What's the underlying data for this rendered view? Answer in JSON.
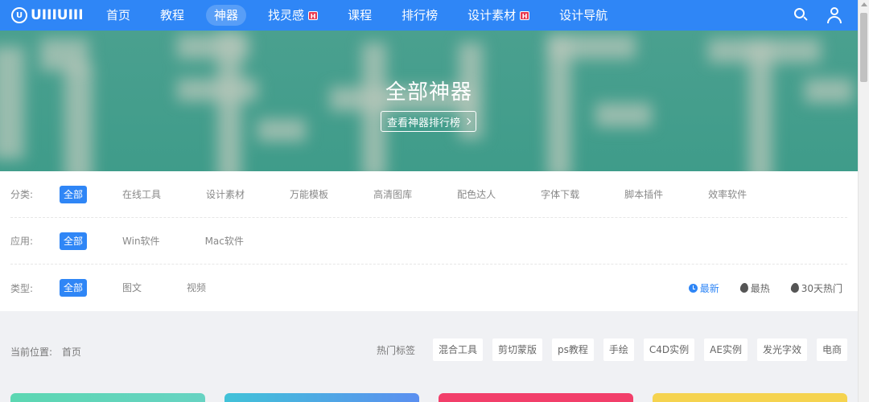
{
  "header": {
    "logo_text": "UIIIUIII",
    "logo_sub": "",
    "nav": [
      {
        "label": "首页",
        "hot": false
      },
      {
        "label": "教程",
        "hot": false
      },
      {
        "label": "神器",
        "hot": false,
        "active": true
      },
      {
        "label": "找灵感",
        "hot": true
      },
      {
        "label": "课程",
        "hot": false
      },
      {
        "label": "排行榜",
        "hot": false
      },
      {
        "label": "设计素材",
        "hot": true
      },
      {
        "label": "设计导航",
        "hot": false
      }
    ],
    "hot_badge": "H",
    "icons": [
      "search-icon",
      "user-icon"
    ],
    "bg_color": "#2f86f6"
  },
  "banner": {
    "title": "全部神器",
    "button_label": "查看神器排行榜"
  },
  "filters": {
    "rows": [
      {
        "label": "分类:",
        "options": [
          "全部",
          "在线工具",
          "设计素材",
          "万能模板",
          "高清图库",
          "配色达人",
          "字体下载",
          "脚本插件",
          "效率软件"
        ],
        "active": 0
      },
      {
        "label": "应用:",
        "options": [
          "全部",
          "Win软件",
          "Mac软件"
        ],
        "active": 0
      },
      {
        "label": "类型:",
        "options": [
          "全部",
          "图文",
          "视频"
        ],
        "active": 0
      }
    ],
    "sorts": [
      {
        "label": "最新",
        "icon": "clock-icon",
        "active": true
      },
      {
        "label": "最热",
        "icon": "flame-icon",
        "active": false
      },
      {
        "label": "30天热门",
        "icon": "flame-icon",
        "active": false
      }
    ],
    "accent_color": "#2f86f6"
  },
  "breadcrumb": {
    "label": "当前位置:",
    "home": "首页"
  },
  "hot_tags": {
    "label": "热门标签",
    "tags": [
      "混合工具",
      "剪切蒙版",
      "ps教程",
      "手绘",
      "C4D实例",
      "AE实例",
      "发光字效",
      "电商"
    ]
  }
}
